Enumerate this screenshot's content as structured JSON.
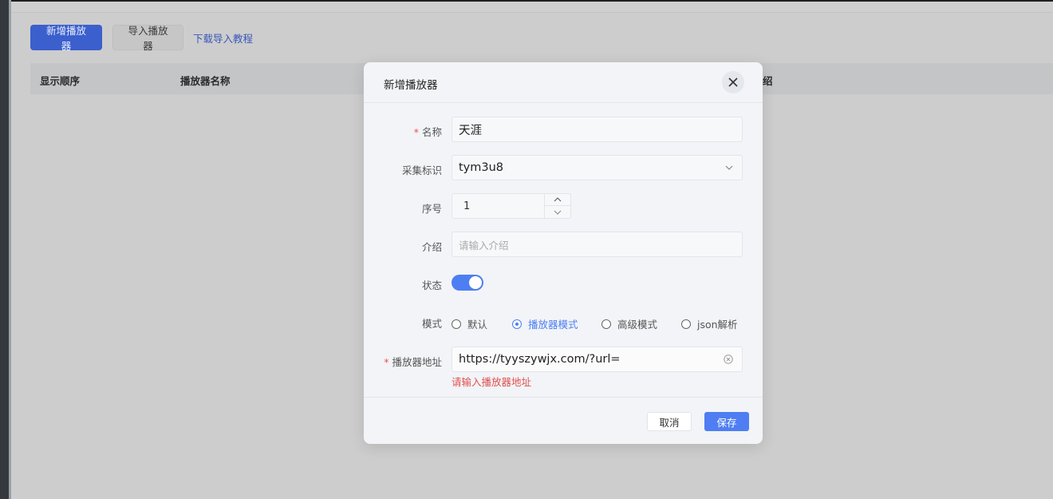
{
  "toolbar": {
    "add_label": "新增播放器",
    "import_label": "导入播放器",
    "tutorial_link": "下载导入教程"
  },
  "table": {
    "columns": [
      "显示顺序",
      "播放器名称",
      "绍"
    ]
  },
  "dialog": {
    "title": "新增播放器",
    "fields": {
      "name": {
        "label": "名称",
        "required": "*",
        "value": "天涯"
      },
      "collect_id": {
        "label": "采集标识",
        "value": "tym3u8"
      },
      "order": {
        "label": "序号",
        "value": "1"
      },
      "intro": {
        "label": "介绍",
        "placeholder": "请输入介绍"
      },
      "status": {
        "label": "状态",
        "enabled": true
      },
      "mode": {
        "label": "模式",
        "options": [
          "默认",
          "播放器模式",
          "高级模式",
          "json解析"
        ],
        "selected": "播放器模式"
      },
      "url": {
        "label": "播放器地址",
        "required": "*",
        "value": "https://tyyszywjx.com/?url=",
        "error": "请输入播放器地址"
      }
    },
    "cancel_label": "取消",
    "save_label": "保存"
  },
  "colors": {
    "primary": "#4e7ef2",
    "error": "#e05050"
  }
}
